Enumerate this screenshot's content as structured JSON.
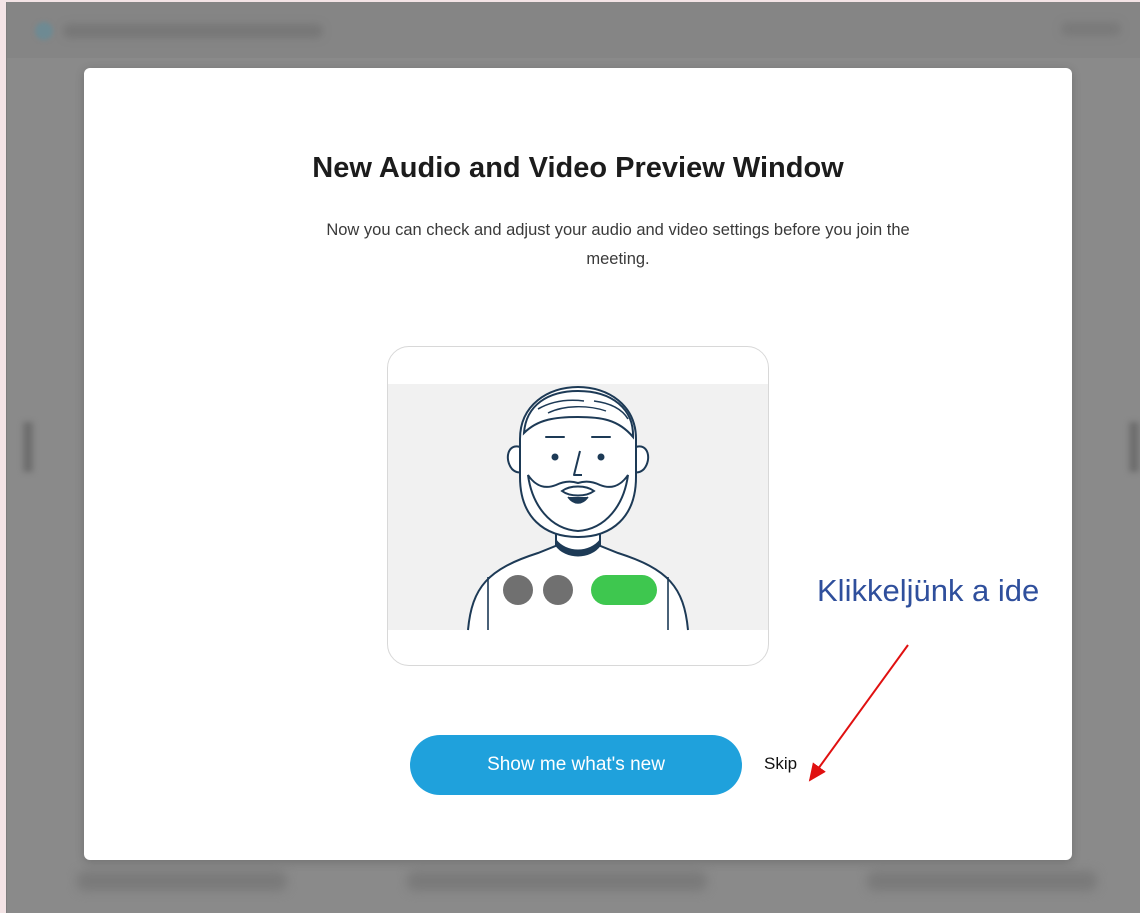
{
  "modal": {
    "title": "New Audio and Video Preview Window",
    "description": "Now you can check and adjust your audio and video settings before you join the meeting.",
    "primary_button_label": "Show me what's new",
    "skip_label": "Skip"
  },
  "annotation": {
    "text": "Klikkeljünk a ide"
  },
  "icons": {
    "illustration": "avatar-preview-illustration",
    "mic_indicator": "gray-dot",
    "camera_indicator": "gray-dot",
    "join_indicator": "green-pill"
  },
  "colors": {
    "primary_button": "#1fa1dc",
    "join_pill": "#3ec74f",
    "indicator_gray": "#707070",
    "annotation_text": "#2f4f9c",
    "annotation_arrow": "#e01010"
  }
}
